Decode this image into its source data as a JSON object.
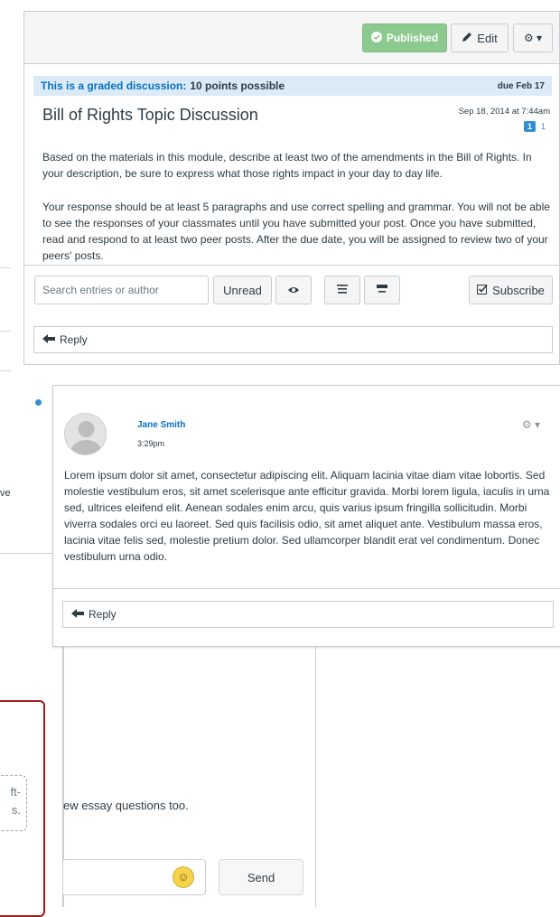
{
  "toolbar": {
    "published_label": "Published",
    "edit_label": "Edit",
    "gear_label": "⚙ ▾"
  },
  "discussion": {
    "graded_label": "This is a graded discussion:",
    "points": "10 points possible",
    "due": "due Feb 17",
    "title": "Bill of Rights Topic Discussion",
    "date": "Sep 18, 2014 at 7:44am",
    "unread_count": "1",
    "total_count": "1",
    "para1": "Based on the materials in this module, describe at least two of the amendments in the Bill of Rights. In your description, be sure to express what those rights impact in your day to day life.",
    "para2": "Your response should be at least 5 paragraphs and use correct spelling and grammar. You will not be able to see the responses of your classmates until you have submitted your post. Once you have submitted, read and respond to at least two peer posts. After the due date, you will be assigned to review two of your peers' posts."
  },
  "filters": {
    "search_placeholder": "Search entries or author",
    "unread_label": "Unread",
    "subscribe_label": "Subscribe"
  },
  "reply_label": "Reply",
  "entry": {
    "author": "Jane Smith",
    "time": "3:29pm",
    "text": "Lorem ipsum dolor sit amet, consectetur adipiscing elit. Aliquam lacinia vitae diam vitae lobortis. Sed molestie vestibulum eros, sit amet scelerisque ante efficitur gravida. Morbi lorem ligula, iaculis in urna sed, ultrices eleifend elit. Aenean sodales enim arcu, quis varius ipsum fringilla sollicitudin. Morbi viverra sodales orci eu laoreet. Sed quis facilisis odio, sit amet aliquet ante. Vestibulum massa eros, lacinia vitae felis sed, molestie pretium dolor. Sed ullamcorper blandit erat vel condimentum. Donec vestibulum urna odio.",
    "reply_label": "Reply"
  },
  "background": {
    "side_text": "ve",
    "chat_text": "ew essay questions too.",
    "dashed_text_1": "ft-",
    "dashed_text_2": "s.",
    "send_label": "Send"
  },
  "colors": {
    "published": "#8bc98e",
    "link_blue": "#0770c2",
    "banner_bg": "#dbeaf6",
    "unread_dot": "#2f8ed8",
    "red_border": "#9e1b1b"
  }
}
